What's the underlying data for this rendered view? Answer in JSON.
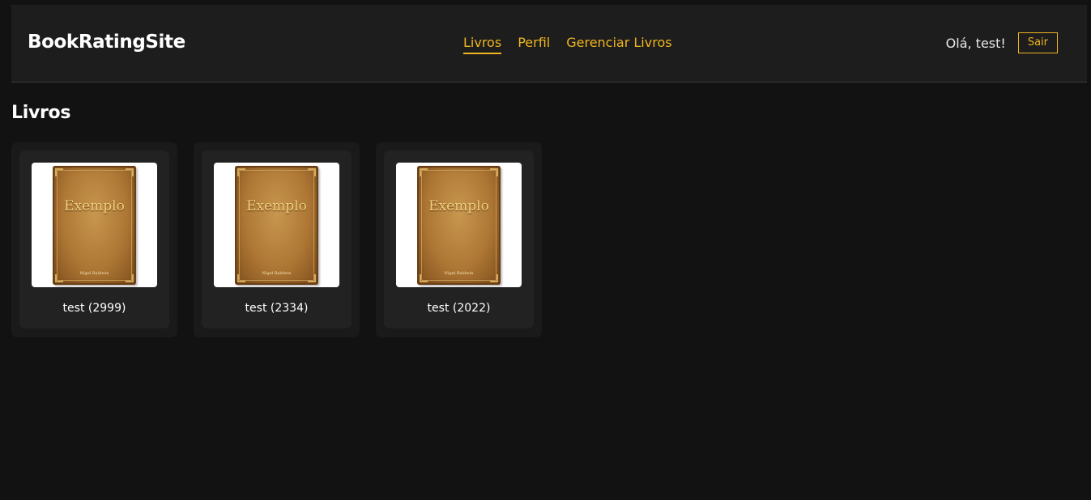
{
  "header": {
    "brand": "BookRatingSite",
    "nav": [
      "Livros",
      "Perfil",
      "Gerenciar Livros"
    ],
    "active_nav": "Livros",
    "greeting": "Olá, test!",
    "logout_label": "Sair"
  },
  "main": {
    "title": "Livros",
    "books": [
      {
        "caption": "test (2999)",
        "cover_title": "Exemplo",
        "cover_author": "Nigel Baldwin"
      },
      {
        "caption": "test (2334)",
        "cover_title": "Exemplo",
        "cover_author": "Nigel Baldwin"
      },
      {
        "caption": "test (2022)",
        "cover_title": "Exemplo",
        "cover_author": "Nigel Baldwin"
      }
    ]
  },
  "colors": {
    "background": "#121212",
    "header_bg": "#1d1d1d",
    "card_bg": "#1a1a1a",
    "accent": "#f0b51e"
  }
}
